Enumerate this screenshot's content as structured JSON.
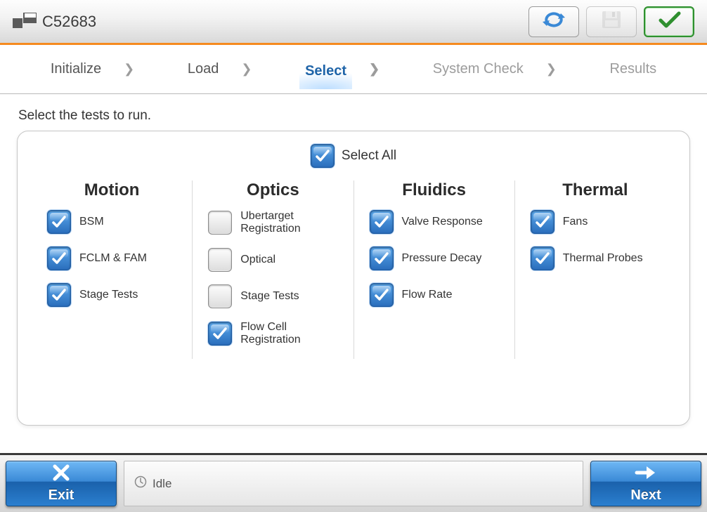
{
  "header": {
    "device_id": "C52683",
    "refresh_label": "Refresh",
    "save_label": "Save",
    "confirm_label": "Confirm"
  },
  "wizard": {
    "steps": [
      "Initialize",
      "Load",
      "Select",
      "System Check",
      "Results"
    ],
    "active_index": 2
  },
  "main": {
    "prompt": "Select the tests to run.",
    "select_all_label": "Select All",
    "select_all_checked": true,
    "groups": [
      {
        "title": "Motion",
        "items": [
          {
            "label": "BSM",
            "checked": true
          },
          {
            "label": "FCLM & FAM",
            "checked": true
          },
          {
            "label": "Stage Tests",
            "checked": true
          }
        ]
      },
      {
        "title": "Optics",
        "items": [
          {
            "label": "Ubertarget Registration",
            "checked": false
          },
          {
            "label": "Optical",
            "checked": false
          },
          {
            "label": "Stage Tests",
            "checked": false
          },
          {
            "label": "Flow Cell Registration",
            "checked": true
          }
        ]
      },
      {
        "title": "Fluidics",
        "items": [
          {
            "label": "Valve Response",
            "checked": true
          },
          {
            "label": "Pressure Decay",
            "checked": true
          },
          {
            "label": "Flow Rate",
            "checked": true
          }
        ]
      },
      {
        "title": "Thermal",
        "items": [
          {
            "label": "Fans",
            "checked": true
          },
          {
            "label": "Thermal Probes",
            "checked": true
          }
        ]
      }
    ]
  },
  "footer": {
    "exit_label": "Exit",
    "next_label": "Next",
    "status_label": "Idle"
  },
  "colors": {
    "accent_blue": "#2b7fcf",
    "accent_orange": "#f58a1f",
    "success_green": "#2f8f2f"
  }
}
